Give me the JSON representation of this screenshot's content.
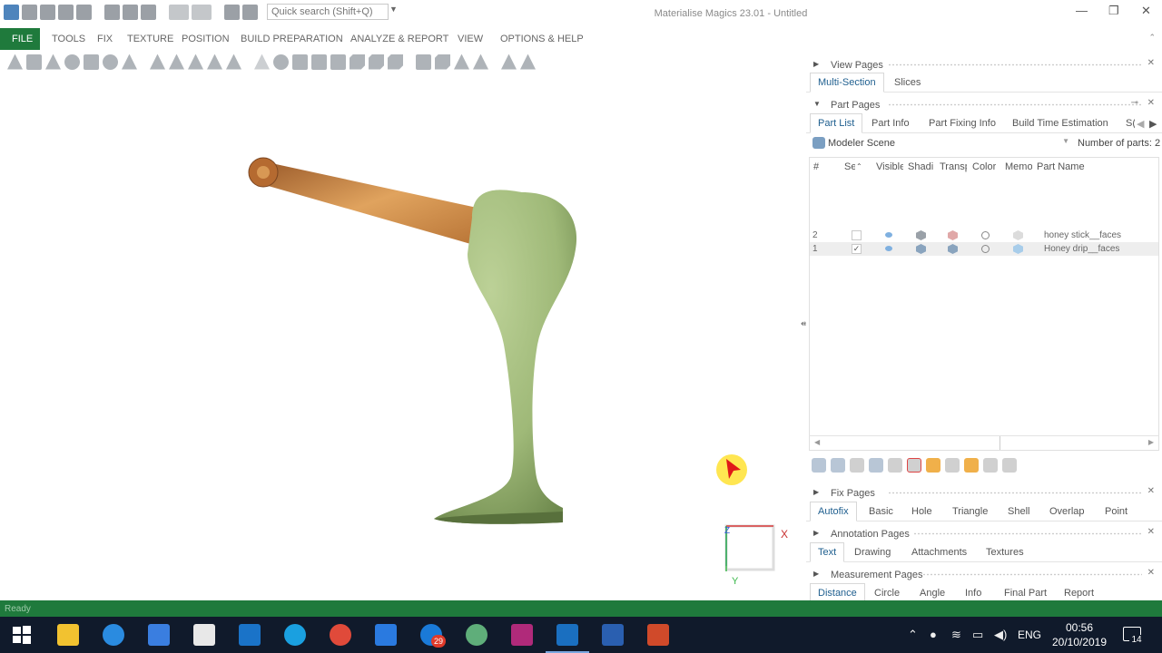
{
  "app": {
    "title": "Materialise Magics 23.01 - Untitled",
    "search_placeholder": "Quick search (Shift+Q)"
  },
  "window_controls": {
    "minimize": "—",
    "restore": "❐",
    "close": "✕"
  },
  "ribbon": {
    "tabs": [
      "FILE",
      "TOOLS",
      "FIX",
      "TEXTURE",
      "POSITION",
      "BUILD PREPARATION",
      "ANALYZE & REPORT",
      "VIEW",
      "OPTIONS & HELP"
    ],
    "active_tab": "FILE"
  },
  "viewport": {
    "axis_labels": {
      "x": "X",
      "y": "Y",
      "z": "Z"
    }
  },
  "panel": {
    "view_pages": {
      "title": "View Pages",
      "tabs": [
        "Multi-Section",
        "Slices"
      ],
      "active_tab": "Multi-Section"
    },
    "part_pages": {
      "title": "Part Pages",
      "tabs": [
        "Part List",
        "Part Info",
        "Part Fixing Info",
        "Build Time Estimation",
        "S("
      ],
      "active_tab": "Part List",
      "scene": "Modeler Scene",
      "number_of_parts_label": "Number of parts: 2",
      "columns": [
        "#",
        "Se",
        "Visible",
        "Shadi",
        "Transp",
        "Color",
        "Memo",
        "Part Name"
      ],
      "rows": [
        {
          "num": "2",
          "selected": false,
          "checked": "",
          "name": "honey stick__faces"
        },
        {
          "num": "1",
          "selected": true,
          "checked": "✓",
          "name": "Honey drip__faces"
        }
      ]
    },
    "fix_pages": {
      "title": "Fix Pages",
      "tabs": [
        "Autofix",
        "Basic",
        "Hole",
        "Triangle",
        "Shell",
        "Overlap",
        "Point"
      ],
      "active_tab": "Autofix"
    },
    "annotation_pages": {
      "title": "Annotation Pages",
      "tabs": [
        "Text",
        "Drawing",
        "Attachments",
        "Textures"
      ],
      "active_tab": "Text"
    },
    "measurement_pages": {
      "title": "Measurement Pages",
      "tabs": [
        "Distance",
        "Circle",
        "Angle",
        "Info",
        "Final Part",
        "Report"
      ],
      "active_tab": "Distance"
    }
  },
  "status": {
    "text": "Ready"
  },
  "taskbar": {
    "apps": [
      "start-icon",
      "file-explorer-icon",
      "internet-explorer-icon",
      "visual-studio-icon",
      "calculator-icon",
      "outlook-icon",
      "skype-icon",
      "chrome-icon",
      "pencil-icon",
      "skype-business-icon",
      "globe-app-icon",
      "teams-icon",
      "magics-icon",
      "word-icon",
      "powerpoint-icon"
    ],
    "badge_count": "29",
    "language": "ENG",
    "time": "00:56",
    "date": "20/10/2019",
    "notifications": "14"
  },
  "colors": {
    "ribbon_green": "#1f7a3c",
    "model_green": "#a4bd7a",
    "wood": "#c98a45",
    "taskbar": "#101a2b"
  }
}
